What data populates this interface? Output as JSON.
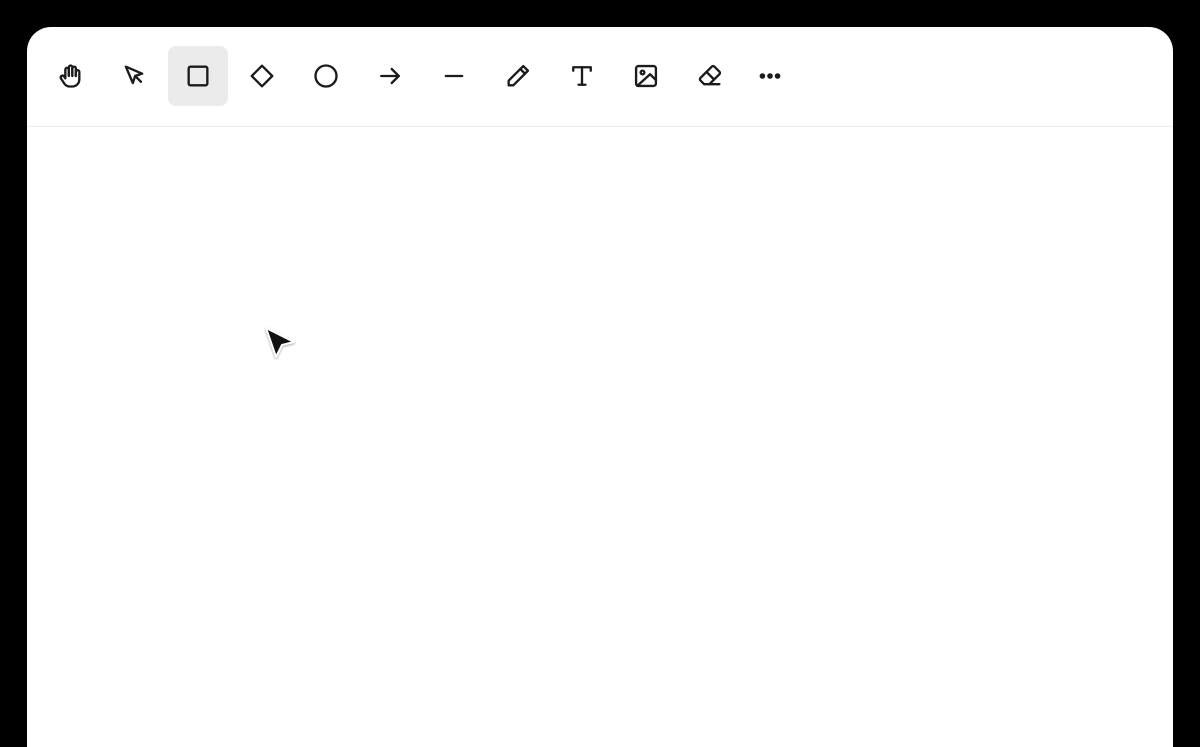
{
  "toolbar": {
    "active_tool": "rectangle",
    "tools": [
      {
        "id": "hand",
        "icon": "hand-icon"
      },
      {
        "id": "select",
        "icon": "pointer-arrow-icon"
      },
      {
        "id": "rectangle",
        "icon": "square-icon"
      },
      {
        "id": "diamond",
        "icon": "diamond-icon"
      },
      {
        "id": "ellipse",
        "icon": "circle-icon"
      },
      {
        "id": "arrow",
        "icon": "arrow-right-icon"
      },
      {
        "id": "line",
        "icon": "line-icon"
      },
      {
        "id": "draw",
        "icon": "pencil-icon"
      },
      {
        "id": "text",
        "icon": "text-icon"
      },
      {
        "id": "image",
        "icon": "image-icon"
      },
      {
        "id": "eraser",
        "icon": "eraser-icon"
      },
      {
        "id": "more",
        "icon": "more-dots-icon"
      }
    ]
  },
  "colors": {
    "background": "#000000",
    "window": "#ffffff",
    "active_tool_bg": "#ebebeb",
    "icon_stroke": "#1b1b1b"
  },
  "canvas": {
    "cursor_icon": "mouse-pointer-icon"
  }
}
